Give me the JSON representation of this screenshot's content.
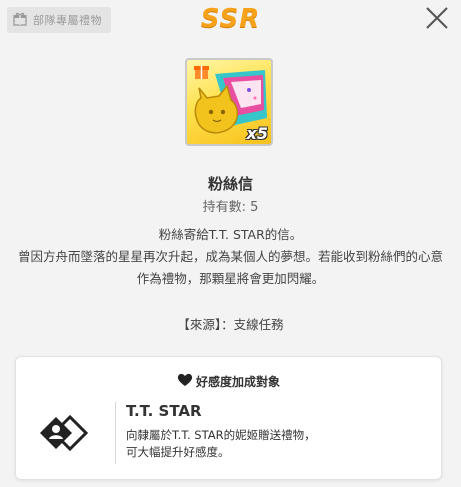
{
  "header": {
    "exclusive_tag": "部隊專屬禮物",
    "rarity": "SSR",
    "close_icon": "close-icon"
  },
  "item": {
    "quantity_badge": "x5",
    "name": "粉絲信",
    "held_label": "持有數: 5",
    "description": [
      "粉絲寄給T.T. STAR的信。",
      "曾因方舟而墜落的星星再次升起，成為某個人的夢想。若能收到粉絲們的心意",
      "作為禮物，那顆星將會更加閃耀。"
    ],
    "source": "【來源】：支線任務"
  },
  "affection_panel": {
    "title": "好感度加成對象",
    "heart_icon": "heart-icon",
    "character_name": "T.T. STAR",
    "character_desc": [
      "向隸屬於T.T. STAR的妮姬贈送禮物，",
      "可大幅提升好感度。"
    ]
  },
  "colors": {
    "background": "#f3f3f3",
    "rarity": "#f6a21b",
    "item_gold": "#ffe14d"
  }
}
